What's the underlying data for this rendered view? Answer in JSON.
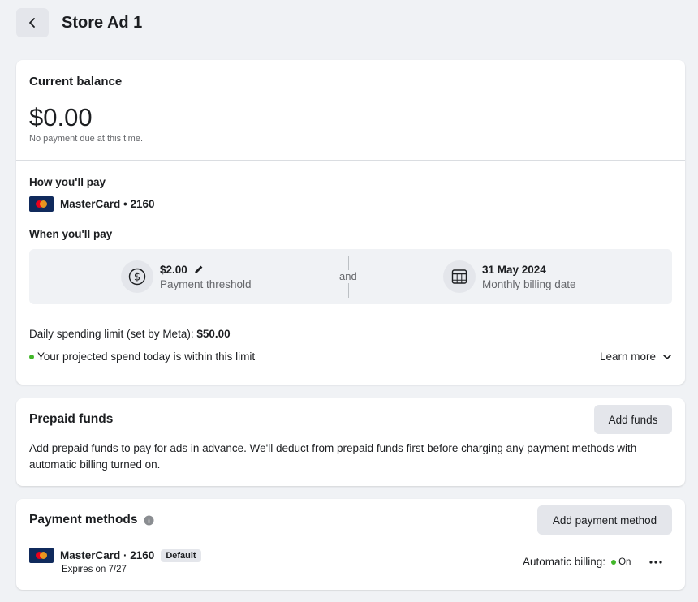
{
  "header": {
    "title": "Store Ad 1"
  },
  "balance": {
    "title": "Current balance",
    "amount": "$0.00",
    "note": "No payment due at this time."
  },
  "how_pay": {
    "title": "How you'll pay",
    "card_label": "MasterCard • 2160"
  },
  "when_pay": {
    "title": "When you'll pay",
    "threshold_value": "$2.00",
    "threshold_label": "Payment threshold",
    "and": "and",
    "billing_date_value": "31 May 2024",
    "billing_date_label": "Monthly billing date"
  },
  "limit": {
    "text": "Daily spending limit (set by Meta): ",
    "value": "$50.00",
    "projected": "Your projected spend today is within this limit",
    "learn_more": "Learn more"
  },
  "prepaid": {
    "title": "Prepaid funds",
    "add_button": "Add funds",
    "description": "Add prepaid funds to pay for ads in advance. We'll deduct from prepaid funds first before charging any payment methods with automatic billing turned on."
  },
  "methods": {
    "title": "Payment methods",
    "add_button": "Add payment method",
    "card_label": "MasterCard · 2160",
    "badge": "Default",
    "expires": "Expires on 7/27",
    "auto_billing_label": "Automatic billing:",
    "auto_billing_state": "On"
  },
  "colors": {
    "background": "#f0f2f5",
    "card": "#ffffff",
    "button": "#e4e6eb",
    "status_green": "#42b72a",
    "mastercard_navy": "#102a5c"
  },
  "icons": {
    "back": "chevron-left-icon",
    "dollar": "dollar-circle-icon",
    "edit": "pencil-icon",
    "calendar": "calendar-icon",
    "expand": "chevron-down-icon",
    "info": "info-icon",
    "more": "more-horizontal-icon"
  }
}
